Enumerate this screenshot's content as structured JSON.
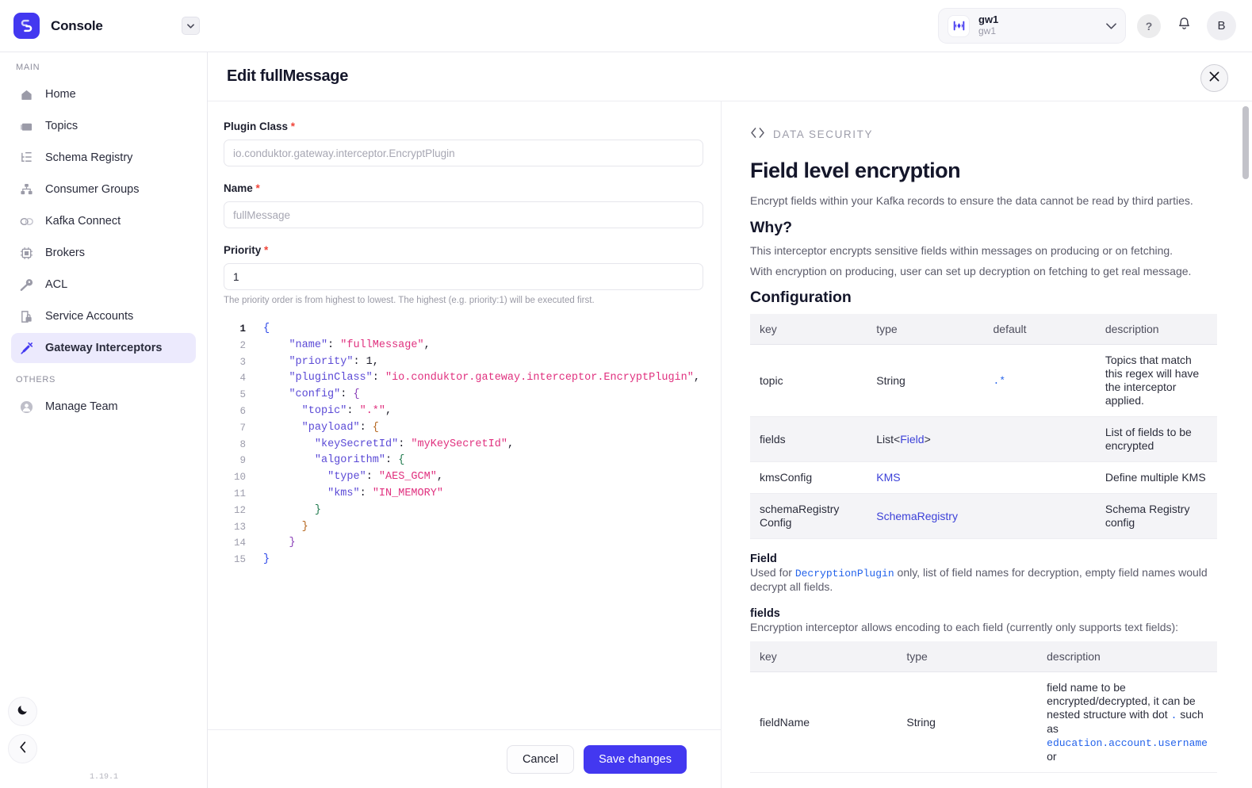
{
  "topbar": {
    "brand_name": "Console",
    "brand_logo_icon": "conduktor-logo-icon",
    "brand_caret_icon": "caret-down-icon",
    "cluster": {
      "icon": "gateway-icon",
      "name": "gw1",
      "subtitle": "gw1",
      "chevron_icon": "chevron-down-icon"
    },
    "help_label": "?",
    "help_icon": "question-mark-icon",
    "notifications_icon": "bell-icon",
    "avatar_initial": "B"
  },
  "sidebar": {
    "groups": [
      {
        "label": "MAIN",
        "items": [
          {
            "label": "Home",
            "icon": "home-icon",
            "active": false
          },
          {
            "label": "Topics",
            "icon": "folder-icon",
            "active": false
          },
          {
            "label": "Schema Registry",
            "icon": "schema-tree-icon",
            "active": false
          },
          {
            "label": "Consumer Groups",
            "icon": "consumer-groups-icon",
            "active": false
          },
          {
            "label": "Kafka Connect",
            "icon": "connect-link-icon",
            "active": false
          },
          {
            "label": "Brokers",
            "icon": "chip-icon",
            "active": false
          },
          {
            "label": "ACL",
            "icon": "key-icon",
            "active": false
          },
          {
            "label": "Service Accounts",
            "icon": "service-account-icon",
            "active": false
          },
          {
            "label": "Gateway Interceptors",
            "icon": "interceptor-plug-icon",
            "active": true
          }
        ]
      },
      {
        "label": "OTHERS",
        "items": [
          {
            "label": "Manage Team",
            "icon": "user-icon",
            "active": false
          }
        ]
      }
    ],
    "dark_mode_icon": "moon-icon",
    "collapse_icon": "chevron-left-icon",
    "version": "1.19.1"
  },
  "modal": {
    "title": "Edit fullMessage",
    "close_icon": "close-icon"
  },
  "form": {
    "plugin_class": {
      "label": "Plugin Class",
      "required_marker": "*",
      "value": "",
      "placeholder": "io.conduktor.gateway.interceptor.EncryptPlugin"
    },
    "name": {
      "label": "Name",
      "required_marker": "*",
      "value": "",
      "placeholder": "fullMessage"
    },
    "priority": {
      "label": "Priority",
      "required_marker": "*",
      "value": "1",
      "placeholder": "",
      "helper": "The priority order is from highest to lowest. The highest (e.g. priority:1) will be executed first."
    }
  },
  "editor": {
    "lines": [
      {
        "n": "1",
        "text": "{"
      },
      {
        "n": "2",
        "text": "    \"name\": \"fullMessage\","
      },
      {
        "n": "3",
        "text": "    \"priority\": 1,"
      },
      {
        "n": "4",
        "text": "    \"pluginClass\": \"io.conduktor.gateway.interceptor.EncryptPlugin\","
      },
      {
        "n": "5",
        "text": "    \"config\": {"
      },
      {
        "n": "6",
        "text": "      \"topic\": \".*\","
      },
      {
        "n": "7",
        "text": "      \"payload\": {"
      },
      {
        "n": "8",
        "text": "        \"keySecretId\": \"myKeySecretId\","
      },
      {
        "n": "9",
        "text": "        \"algorithm\": {"
      },
      {
        "n": "10",
        "text": "          \"type\": \"AES_GCM\","
      },
      {
        "n": "11",
        "text": "          \"kms\": \"IN_MEMORY\""
      },
      {
        "n": "12",
        "text": "        }"
      },
      {
        "n": "13",
        "text": "      }"
      },
      {
        "n": "14",
        "text": "    }"
      },
      {
        "n": "15",
        "text": "}"
      }
    ]
  },
  "footer": {
    "cancel_label": "Cancel",
    "save_label": "Save changes"
  },
  "docs": {
    "eyebrow": "DATA SECURITY",
    "eyebrow_icon": "code-brackets-icon",
    "heading": "Field level encryption",
    "intro": "Encrypt fields within your Kafka records to ensure the data cannot be read by third parties.",
    "why_heading": "Why?",
    "why_p1": "This interceptor encrypts sensitive fields within messages on producing or on fetching.",
    "why_p2": "With encryption on producing, user can set up decryption on fetching to get real message.",
    "configuration_heading": "Configuration",
    "config_table": {
      "columns": [
        "key",
        "type",
        "default",
        "description"
      ],
      "rows": [
        {
          "key": "topic",
          "type": "String",
          "type_link": "",
          "default": ".*",
          "description": "Topics that match this regex will have the interceptor applied."
        },
        {
          "key": "fields",
          "type": "List<",
          "type_link": "Field",
          "type_suffix": ">",
          "default": "",
          "description": "List of fields to be encrypted"
        },
        {
          "key": "kmsConfig",
          "type": "",
          "type_link": "KMS",
          "type_suffix": "",
          "default": "",
          "description": "Define multiple KMS"
        },
        {
          "key": "schemaRegistry Config",
          "type": "",
          "type_link": "SchemaRegistry",
          "type_suffix": "",
          "default": "",
          "description": "Schema Registry config"
        }
      ]
    },
    "field_heading": "Field",
    "field_p_pre": "Used for ",
    "field_p_code": "DecryptionPlugin",
    "field_p_post": " only, list of field names for decryption, empty field names would decrypt all fields.",
    "fields_heading": "fields",
    "fields_p": "Encryption interceptor allows encoding to each field (currently only supports text fields):",
    "fields_table": {
      "columns": [
        "key",
        "type",
        "description"
      ],
      "rows": [
        {
          "key": "fieldName",
          "type": "String",
          "desc_pre": "field name to be encrypted/decrypted, it can be nested structure with dot ",
          "desc_code1": ".",
          "desc_mid": " such as ",
          "desc_code2": "education.account.username",
          "desc_post": " or"
        }
      ]
    }
  }
}
